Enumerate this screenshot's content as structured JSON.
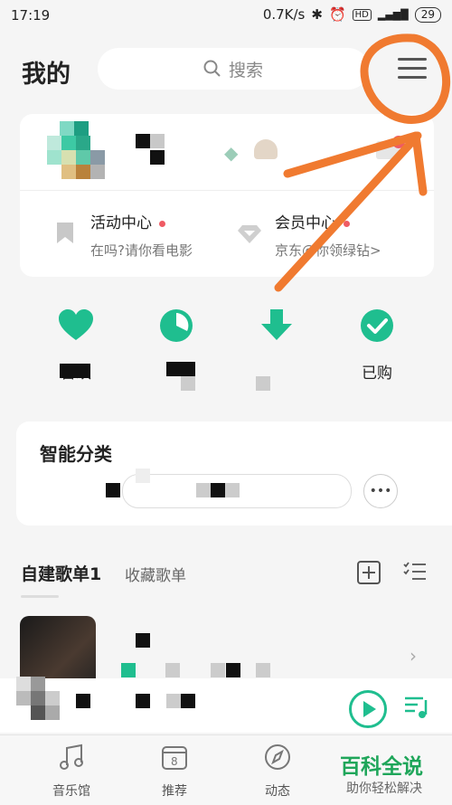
{
  "status_bar": {
    "time": "17:19",
    "speed": "0.7K/s",
    "battery": "29"
  },
  "header": {
    "title": "我的",
    "search_placeholder": "搜索"
  },
  "quick_links": [
    {
      "title": "活动中心",
      "subtitle": "在吗?请你看电影"
    },
    {
      "title": "会员中心",
      "subtitle": "京东@你领绿钻>"
    }
  ],
  "actions": [
    {
      "label": "喜欢",
      "icon": "heart-icon"
    },
    {
      "label": "",
      "icon": "clock-icon"
    },
    {
      "label": "",
      "icon": "download-icon"
    },
    {
      "label": "已购",
      "icon": "check-icon"
    }
  ],
  "smart_category": {
    "title": "智能分类"
  },
  "playlist_tabs": {
    "created": "自建歌单1",
    "collected": "收藏歌单"
  },
  "bottom_nav": [
    {
      "label": "音乐馆",
      "icon": "music-note-icon"
    },
    {
      "label": "推荐",
      "icon": "calendar-icon"
    },
    {
      "label": "动态",
      "icon": "compass-icon"
    }
  ],
  "watermark": {
    "title": "百科全说",
    "subtitle": "助你轻松解决"
  },
  "colors": {
    "accent": "#1fbe8f",
    "annotation": "#f07a30"
  }
}
